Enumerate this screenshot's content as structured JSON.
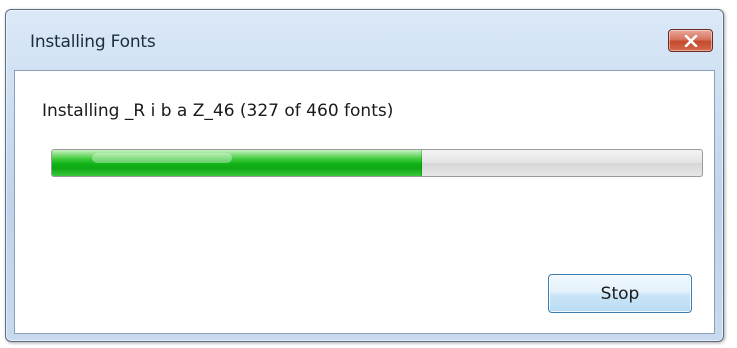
{
  "window": {
    "title": "Installing Fonts"
  },
  "titlebar": {
    "close_icon": "close-icon"
  },
  "status": {
    "text": "Installing _R i b a Z_46 (327 of 460 fonts)"
  },
  "progress": {
    "current": 327,
    "total": 460,
    "fraction": 0.5685
  },
  "buttons": {
    "stop_label": "Stop"
  },
  "colors": {
    "progress_green": "#12b418",
    "close_red": "#c44a2e",
    "window_frame": "#bfd4ec"
  }
}
